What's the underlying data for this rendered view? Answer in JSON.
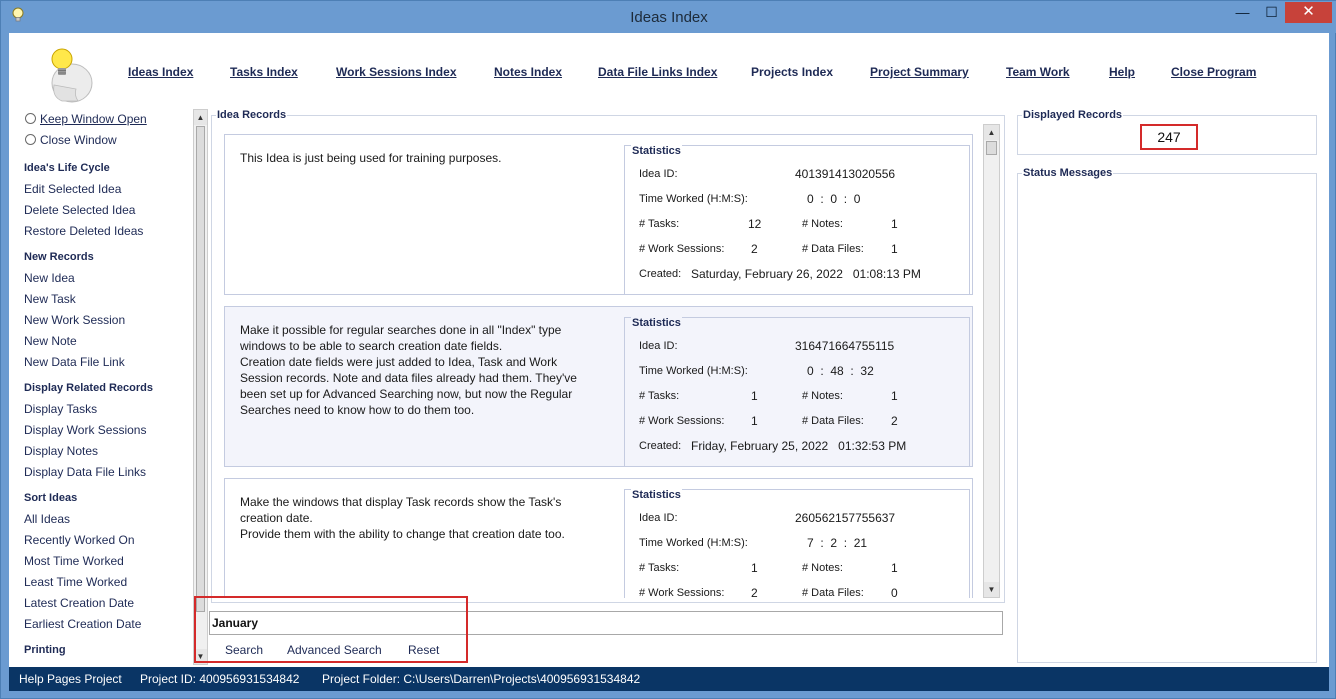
{
  "window": {
    "title": "Ideas Index",
    "minimize_glyph": "—",
    "maximize_glyph": "☐",
    "close_glyph": "✕"
  },
  "nav": {
    "ideas_index": "Ideas Index",
    "tasks_index": "Tasks Index",
    "work_sessions_index": "Work Sessions Index",
    "notes_index": "Notes Index",
    "data_file_links_index": "Data File Links Index",
    "projects_index": "Projects Index",
    "project_summary": "Project Summary",
    "team_work": "Team Work",
    "help": "Help",
    "close_program": "Close Program"
  },
  "sidebar": {
    "keep_window_open": "Keep Window Open",
    "close_window": "Close Window",
    "lifecycle": {
      "heading": "Idea's Life Cycle",
      "items": [
        "Edit Selected Idea",
        "Delete Selected Idea",
        "Restore Deleted Ideas"
      ]
    },
    "new_records": {
      "heading": "New Records",
      "items": [
        "New Idea",
        "New Task",
        "New Work Session",
        "New Note",
        "New Data File Link"
      ]
    },
    "display_related": {
      "heading": "Display Related Records",
      "items": [
        "Display Tasks",
        "Display Work Sessions",
        "Display Notes",
        "Display Data File Links"
      ]
    },
    "sort": {
      "heading": "Sort Ideas",
      "items": [
        "All Ideas",
        "Recently Worked On",
        "Most Time Worked",
        "Least Time Worked",
        "Latest Creation Date",
        "Earliest Creation Date"
      ]
    },
    "printing": {
      "heading": "Printing"
    }
  },
  "records": {
    "group_label": "Idea Records",
    "stats_label": "Statistics",
    "labels": {
      "idea_id": "Idea ID:",
      "time_worked": "Time Worked (H:M:S):",
      "tasks": "# Tasks:",
      "notes": "# Notes:",
      "work_sessions": "# Work Sessions:",
      "data_files": "# Data Files:",
      "created": "Created:"
    },
    "items": [
      {
        "description": "This Idea is just being used for training purposes.",
        "idea_id": "401391413020556",
        "time_h": "0",
        "time_m": "0",
        "time_s": "0",
        "tasks": "12",
        "notes": "1",
        "work_sessions": "2",
        "data_files": "1",
        "created": "Saturday, February 26, 2022   01:08:13 PM"
      },
      {
        "description": "Make it possible for regular searches done in all \"Index\" type windows to be able to search creation date fields.\nCreation date fields were just added to Idea, Task and Work Session records. Note and data files already had them. They've been set up for Advanced Searching now, but now the Regular Searches need to know how to do them too.",
        "idea_id": "316471664755115",
        "time_h": "0",
        "time_m": "48",
        "time_s": "32",
        "tasks": "1",
        "notes": "1",
        "work_sessions": "1",
        "data_files": "2",
        "created": "Friday, February 25, 2022   01:32:53 PM"
      },
      {
        "description": "Make the windows that display Task records show the Task's creation date.\nProvide them with the ability to change that creation date too.",
        "idea_id": "260562157755637",
        "time_h": "7",
        "time_m": "2",
        "time_s": "21",
        "tasks": "1",
        "notes": "1",
        "work_sessions": "2",
        "data_files": "0",
        "created": ""
      }
    ]
  },
  "search": {
    "value": "January",
    "search_label": "Search",
    "advanced_label": "Advanced Search",
    "reset_label": "Reset"
  },
  "right_panel": {
    "displayed_records_label": "Displayed Records",
    "displayed_records_count": "247",
    "status_messages_label": "Status Messages"
  },
  "statusbar": {
    "project_name": "Help Pages Project",
    "project_id": "Project ID:  400956931534842",
    "project_folder": "Project Folder:  C:\\Users\\Darren\\Projects\\400956931534842"
  },
  "colors": {
    "titlebar": "#6b9bd1",
    "nav_text": "#1e2a55",
    "record_alt_bg": "#f3f4fb",
    "highlight_red": "#d42a2a",
    "statusbar": "#0a3565",
    "close_button": "#c7423a"
  },
  "icons": {
    "app": "lightbulb-icon",
    "logo": "lightbulb-head-logo"
  }
}
